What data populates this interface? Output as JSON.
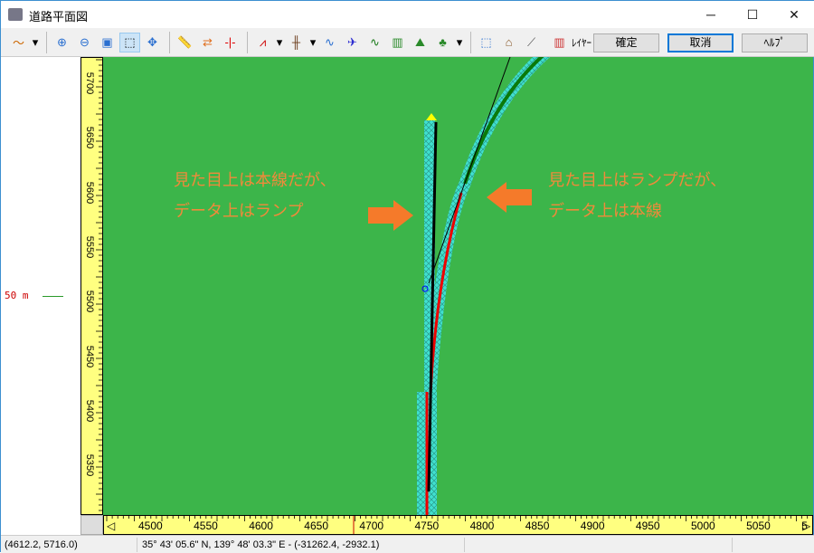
{
  "window": {
    "title": "道路平面図",
    "minimize": "─",
    "maximize": "☐",
    "close": "✕"
  },
  "toolbar": {
    "confirm": "確定",
    "cancel": "取消",
    "help": "ﾍﾙﾌﾟ",
    "layer": "ﾚｲﾔｰ"
  },
  "scale": {
    "label": "50 m"
  },
  "vruler": {
    "ticks": [
      "5700",
      "5650",
      "5600",
      "5550",
      "5500",
      "5450",
      "5400",
      "5350"
    ]
  },
  "hruler": {
    "ticks": [
      "4500",
      "4550",
      "4600",
      "4650",
      "4700",
      "4750",
      "4800",
      "4850",
      "4900",
      "4950",
      "5000",
      "5050",
      "5"
    ]
  },
  "annotations": {
    "left": [
      "見た目上は本線だが、",
      "データ上はランプ"
    ],
    "right": [
      "見た目上はランプだが、",
      "データ上は本線"
    ]
  },
  "status": {
    "coords": "(4612.2, 5716.0)",
    "geo": "35° 43' 05.6\" N, 139° 48' 03.3\" E  -  (-31262.4, -2932.1)"
  },
  "colors": {
    "map": "#3cb54a",
    "ruler": "#ffff80",
    "annotation": "#f08a3a",
    "road": "#40e0d0"
  }
}
